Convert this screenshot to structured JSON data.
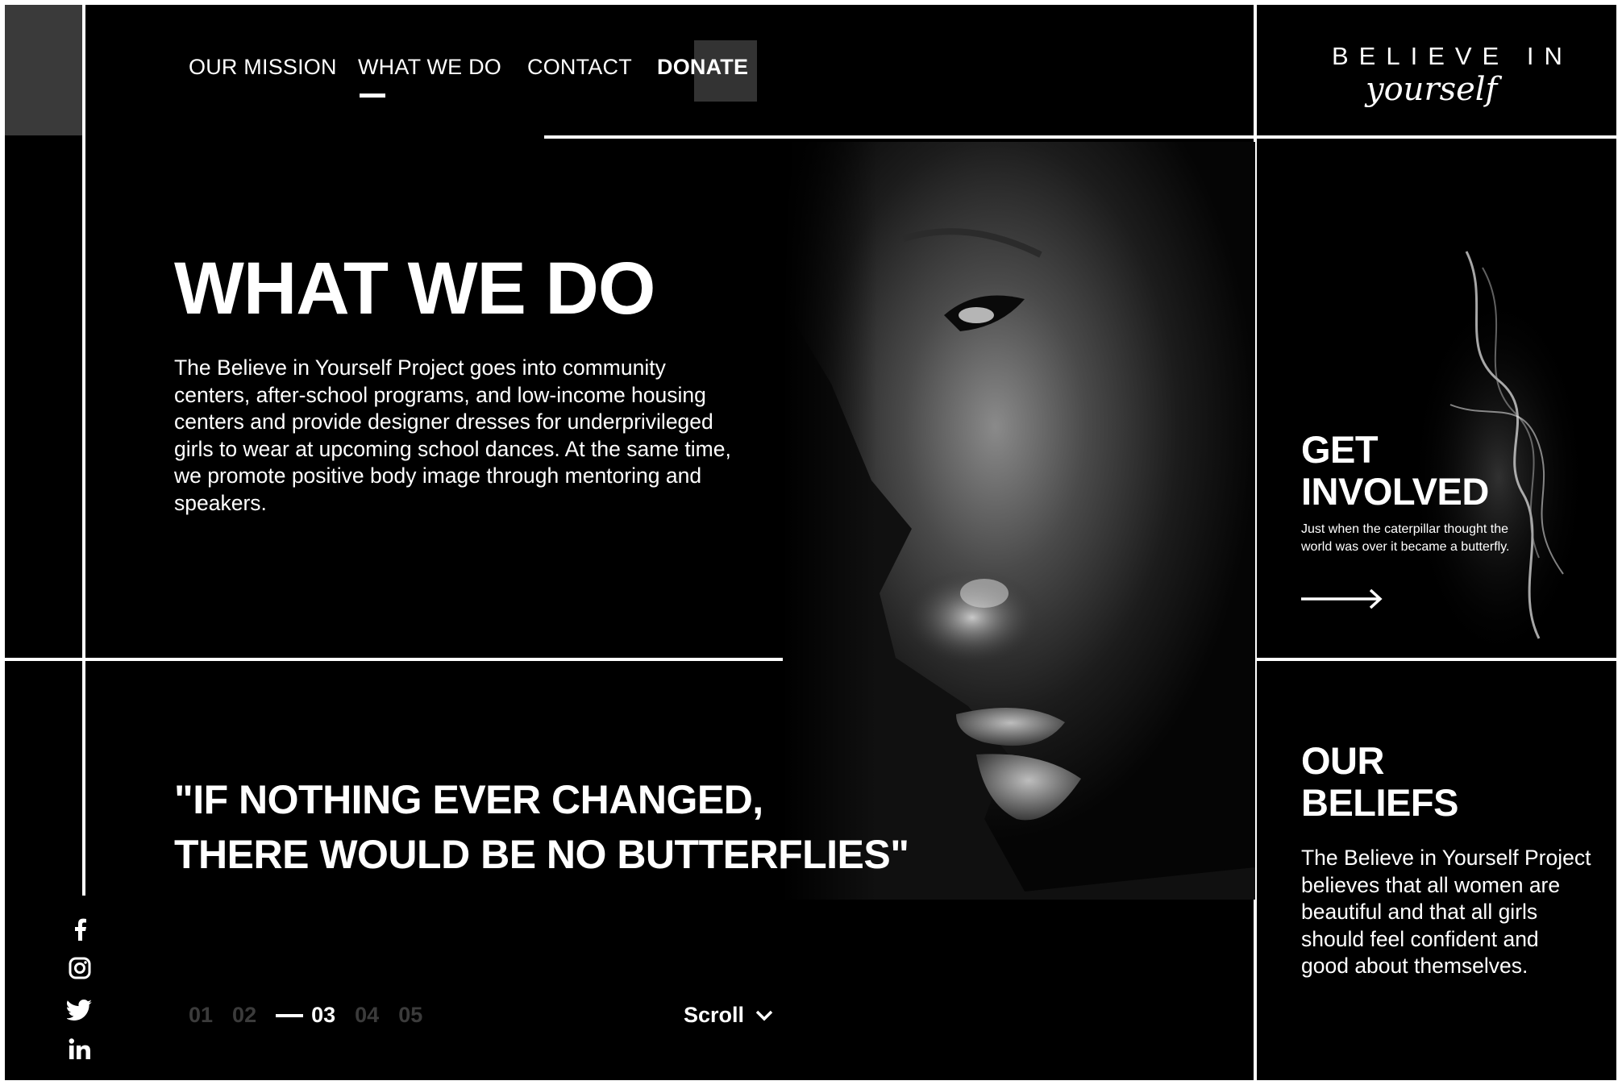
{
  "nav": {
    "items": [
      "OUR MISSION",
      "WHAT WE DO",
      "CONTACT",
      "DONATE"
    ],
    "active": "WHAT WE DO"
  },
  "logo": {
    "line1": "BELIEVE IN",
    "line2": "yourself"
  },
  "hero": {
    "title": "WHAT WE DO",
    "body": "The Believe in Yourself Project goes into community centers, after-school programs, and low-income housing centers and provide designer dresses for underprivileged girls to wear at upcoming school dances. At the same time, we promote positive body image through mentoring and speakers."
  },
  "quote": {
    "line1": "\"IF NOTHING EVER CHANGED,",
    "line2": "THERE WOULD BE NO BUTTERFLIES\""
  },
  "pager": {
    "pages": [
      "01",
      "02",
      "03",
      "04",
      "05"
    ],
    "active_index": 2
  },
  "scroll_label": "Scroll",
  "social": [
    "facebook-icon",
    "instagram-icon",
    "twitter-icon",
    "linkedin-icon"
  ],
  "get_involved": {
    "title_line1": "GET",
    "title_line2": "INVOLVED",
    "text": "Just when the caterpillar thought the world was over it became a butterfly."
  },
  "beliefs": {
    "title_line1": "OUR",
    "title_line2": "BELIEFS",
    "text": "The Believe in Yourself Project believes that all women are beautiful and that all girls should feel confident and good about themselves."
  },
  "colors": {
    "background": "#000000",
    "text": "#ffffff",
    "accent_block": "#3a3a3a",
    "inactive_pager": "#3b3b3b"
  }
}
